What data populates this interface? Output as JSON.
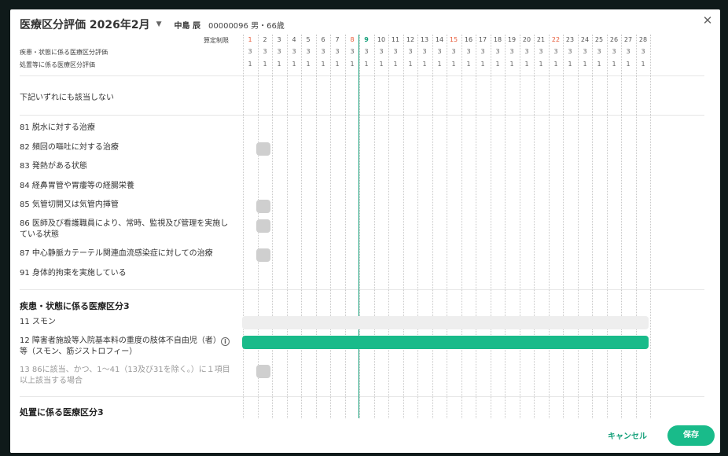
{
  "header": {
    "title": "医療区分評価 2026年2月",
    "patient_name": "中島 辰",
    "patient_info": "00000096  男・66歳"
  },
  "grid": {
    "label_santei": "算定制限",
    "label_disease": "疾患・状態に係る医療区分評価",
    "label_treatment": "処置等に係る医療区分評価",
    "days": [
      "1",
      "2",
      "3",
      "4",
      "5",
      "6",
      "7",
      "8",
      "9",
      "10",
      "11",
      "12",
      "13",
      "14",
      "15",
      "16",
      "17",
      "18",
      "19",
      "20",
      "21",
      "22",
      "23",
      "24",
      "25",
      "26",
      "27",
      "28"
    ],
    "red_days": [
      "1",
      "8",
      "15",
      "22"
    ],
    "today": "9",
    "disease_values": [
      "3",
      "3",
      "3",
      "3",
      "3",
      "3",
      "3",
      "3",
      "3",
      "3",
      "3",
      "3",
      "3",
      "3",
      "3",
      "3",
      "3",
      "3",
      "3",
      "3",
      "3",
      "3",
      "3",
      "3",
      "3",
      "3",
      "3",
      "3"
    ],
    "treatment_values": [
      "1",
      "1",
      "1",
      "1",
      "1",
      "1",
      "1",
      "1",
      "1",
      "1",
      "1",
      "1",
      "1",
      "1",
      "1",
      "1",
      "1",
      "1",
      "1",
      "1",
      "1",
      "1",
      "1",
      "1",
      "1",
      "1",
      "1",
      "1"
    ]
  },
  "rows": {
    "none": "下記いずれにも該当しない",
    "r81": "81 脱水に対する治療",
    "r82": "82 頻回の嘔吐に対する治療",
    "r83": "83 発熱がある状態",
    "r84": "84 経鼻胃管や胃瘻等の経腸栄養",
    "r85": "85 気管切開又は気管内挿管",
    "r86": "86 医師及び看護職員により、常時、監視及び管理を実施している状態",
    "r87": "87 中心静脈カテーテル関連血流感染症に対しての治療",
    "r91": "91 身体的拘束を実施している"
  },
  "section_disease": {
    "title": "疾患・状態に係る医療区分3",
    "r11": "11 スモン",
    "r12": "12 障害者施設等入院基本料の重度の肢体不自由児（者）等（スモン、筋ジストロフィー）",
    "r13": "13 86に該当、かつ、1〜41（13及び31を除く。）に１項目以上該当する場合"
  },
  "section_treatment": {
    "title": "処置に係る医療区分3"
  },
  "footer": {
    "cancel": "キャンセル",
    "save": "保存"
  },
  "colors": {
    "accent": "#19bb8a",
    "today": "#14a07a",
    "holiday": "#e85c3a",
    "chip": "#cfcfcf"
  },
  "icons": {
    "close": "close-icon",
    "caret": "chevron-down-icon",
    "info": "info-icon"
  }
}
